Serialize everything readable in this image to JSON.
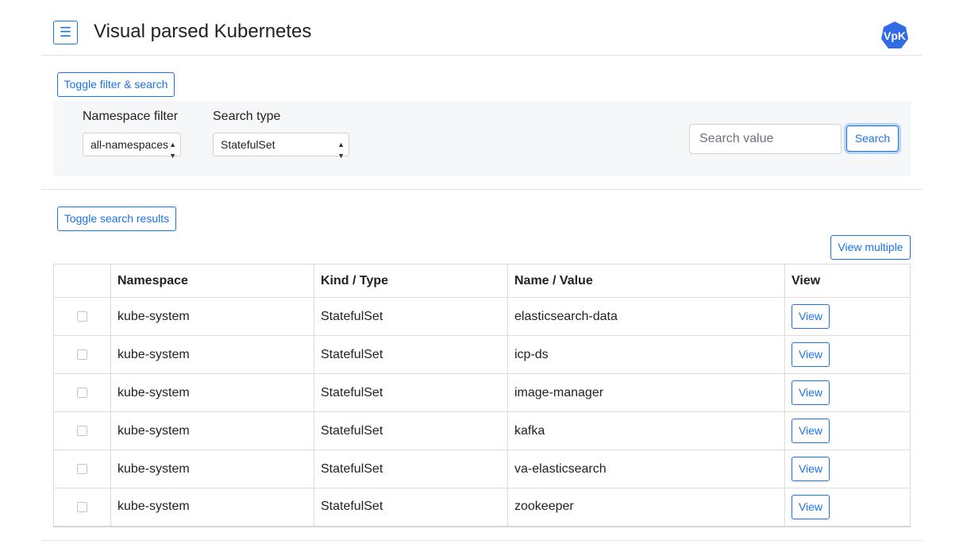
{
  "header": {
    "menu_icon": "☰",
    "title": "Visual parsed Kubernetes",
    "logo_text": "VpK",
    "logo_color": "#326ce5"
  },
  "filter": {
    "toggle_label": "Toggle filter & search",
    "namespace_label": "Namespace filter",
    "namespace_value": "all-namespaces",
    "search_type_label": "Search type",
    "search_type_value": "StatefulSet",
    "search_placeholder": "Search value",
    "search_button": "Search"
  },
  "results": {
    "toggle_label": "Toggle search results",
    "view_multiple_label": "View multiple",
    "columns": [
      "",
      "Namespace",
      "Kind / Type",
      "Name / Value",
      "View"
    ],
    "view_label": "View",
    "rows": [
      {
        "namespace": "kube-system",
        "kind": "StatefulSet",
        "name": "elasticsearch-data"
      },
      {
        "namespace": "kube-system",
        "kind": "StatefulSet",
        "name": "icp-ds"
      },
      {
        "namespace": "kube-system",
        "kind": "StatefulSet",
        "name": "image-manager"
      },
      {
        "namespace": "kube-system",
        "kind": "StatefulSet",
        "name": "kafka"
      },
      {
        "namespace": "kube-system",
        "kind": "StatefulSet",
        "name": "va-elasticsearch"
      },
      {
        "namespace": "kube-system",
        "kind": "StatefulSet",
        "name": "zookeeper"
      }
    ]
  },
  "colors": {
    "accent": "#1a73e8",
    "panel_bg": "#f6f7f8"
  }
}
